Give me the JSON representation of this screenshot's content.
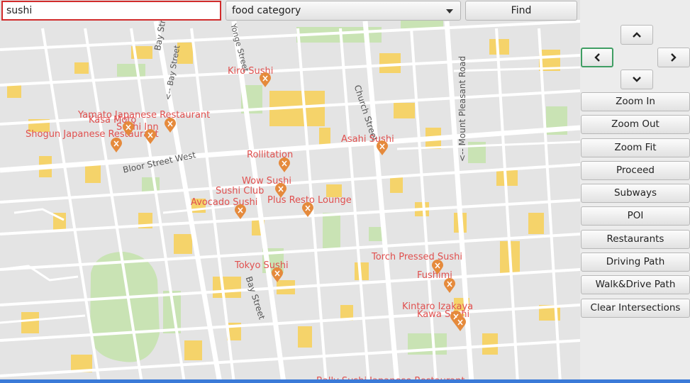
{
  "search": {
    "value": "sushi"
  },
  "category": {
    "value": "food category"
  },
  "find": {
    "label": "Find"
  },
  "nav": {
    "up": "up",
    "left": "left",
    "right": "right",
    "down": "down"
  },
  "buttons": [
    "Zoom In",
    "Zoom Out",
    "Zoom Fit",
    "Proceed",
    "Subways",
    "POI",
    "Restaurants",
    "Driving Path",
    "Walk&Drive Path",
    "Clear Intersections"
  ],
  "streets": [
    "Bay Street",
    "Bay Street",
    "Bay Street",
    "<-- Bay Street",
    "Bloor Street West",
    "Church Street",
    "Yonge Street",
    "<-- Mount Pleasant Road"
  ],
  "restaurants": [
    {
      "name": "Kiro Sushi"
    },
    {
      "name": "Yamato Japanese Restaurant"
    },
    {
      "name": "Kasa Moto"
    },
    {
      "name": "Sushi Inn"
    },
    {
      "name": "Shogun Japanese Restaurant"
    },
    {
      "name": "Asahi Sushi"
    },
    {
      "name": "Rollitation"
    },
    {
      "name": "Wow Sushi"
    },
    {
      "name": "Sushi Club"
    },
    {
      "name": "Avocado Sushi"
    },
    {
      "name": "Plus Resto Lounge"
    },
    {
      "name": "Tokyo Sushi"
    },
    {
      "name": "Torch Pressed Sushi"
    },
    {
      "name": "Fushimi"
    },
    {
      "name": "Kintaro Izakaya"
    },
    {
      "name": "Kawa Sushi"
    },
    {
      "name": "Bally Sushi Japanese Restaurant"
    }
  ],
  "colors": {
    "map_bg": "#e4e4e4",
    "road": "#ffffff",
    "building": "#f5d36a",
    "park": "#c9e3b4",
    "label": "#e0504f",
    "pin": "#e58a3c",
    "focus": "#3f9e63",
    "search_border": "#d12b2b"
  }
}
